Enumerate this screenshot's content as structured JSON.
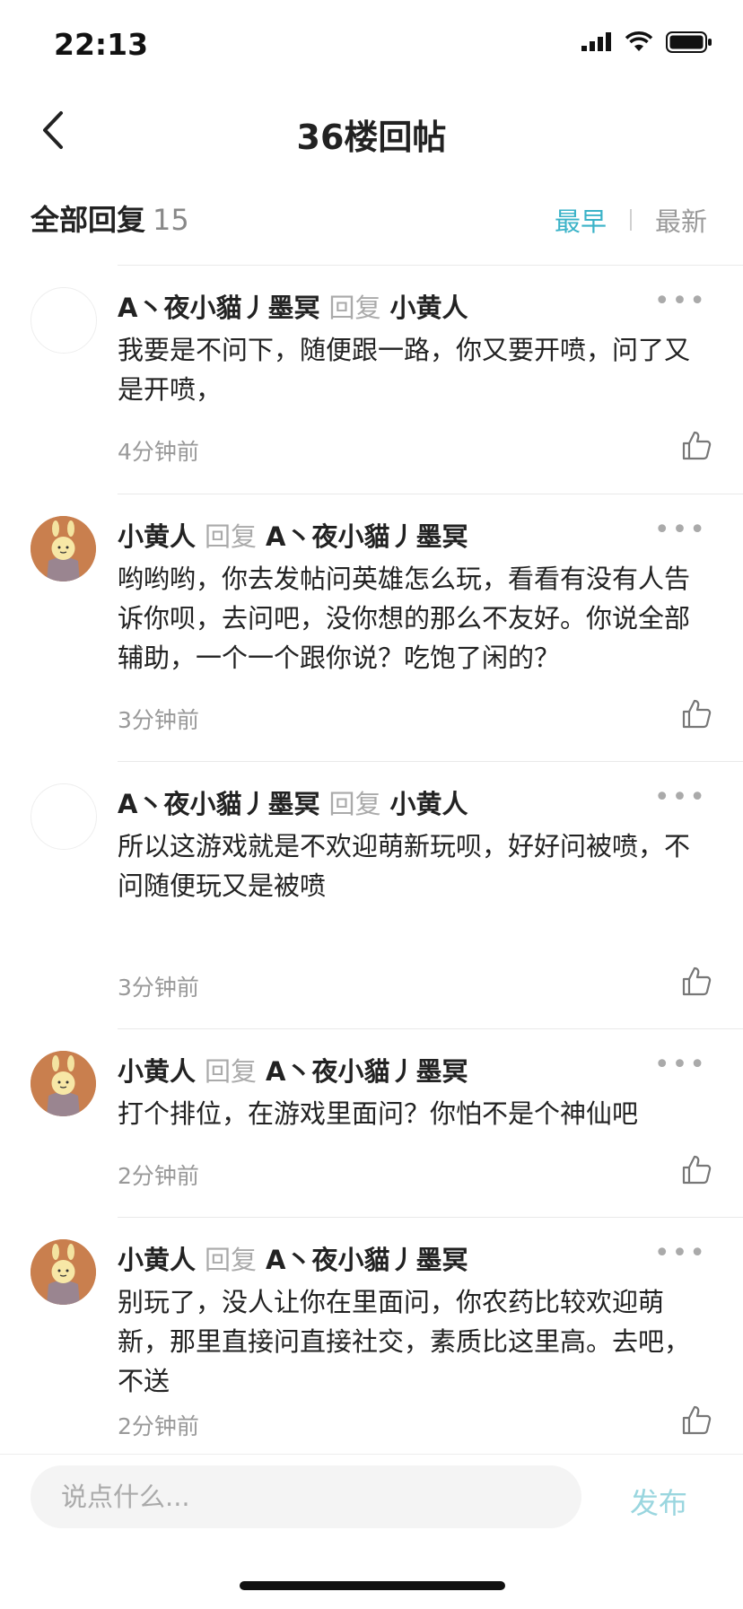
{
  "status": {
    "time": "22:13"
  },
  "nav": {
    "title": "36楼回帖"
  },
  "header": {
    "label": "全部回复",
    "count": "15",
    "sort_earliest": "最早",
    "sort_latest": "最新"
  },
  "replies": [
    {
      "author": "A丶夜小貓丿墨冥",
      "reply_word": "回复",
      "target": "小黄人",
      "avatar": "empty",
      "content": "我要是不问下，随便跟一路，你又要开喷，问了又是开喷，",
      "time": "4分钟前"
    },
    {
      "author": "小黄人",
      "reply_word": "回复",
      "target": "A丶夜小貓丿墨冥",
      "avatar": "cartoon",
      "content": "哟哟哟，你去发帖问英雄怎么玩，看看有没有人告诉你呗，去问吧，没你想的那么不友好。你说全部辅助，一个一个跟你说？吃饱了闲的？",
      "time": "3分钟前"
    },
    {
      "author": "A丶夜小貓丿墨冥",
      "reply_word": "回复",
      "target": "小黄人",
      "avatar": "empty",
      "content": "所以这游戏就是不欢迎萌新玩呗，好好问被喷，不问随便玩又是被喷",
      "time": "3分钟前"
    },
    {
      "author": "小黄人",
      "reply_word": "回复",
      "target": "A丶夜小貓丿墨冥",
      "avatar": "cartoon",
      "content": "打个排位，在游戏里面问？你怕不是个神仙吧",
      "time": "2分钟前"
    },
    {
      "author": "小黄人",
      "reply_word": "回复",
      "target": "A丶夜小貓丿墨冥",
      "avatar": "cartoon",
      "content": "别玩了，没人让你在里面问，你农药比较欢迎萌新，那里直接问直接社交，素质比这里高。去吧，不送",
      "time": "2分钟前"
    }
  ],
  "more_label": "•••",
  "composer": {
    "placeholder": "说点什么...",
    "publish_label": "发布"
  },
  "colors": {
    "accent": "#3bb3c8",
    "publish_disabled": "#9ad6df",
    "avatar_bg": "#c97f4e"
  },
  "icons": {
    "back": "chevron-left-icon",
    "like": "thumbs-up-icon",
    "more": "more-dots-icon"
  }
}
